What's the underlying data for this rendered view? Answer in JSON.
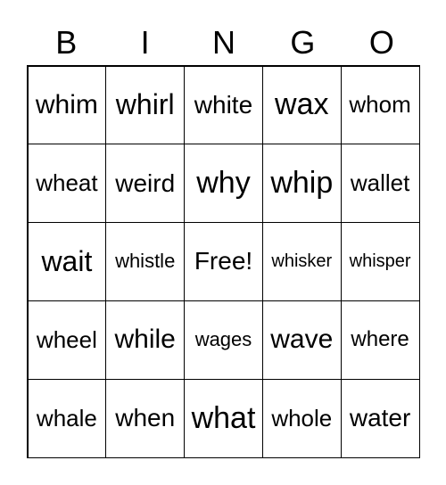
{
  "header": [
    "B",
    "I",
    "N",
    "G",
    "O"
  ],
  "cells": [
    "whim",
    "whirl",
    "white",
    "wax",
    "whom",
    "wheat",
    "weird",
    "why",
    "whip",
    "wallet",
    "wait",
    "whistle",
    "Free!",
    "whisker",
    "whisper",
    "wheel",
    "while",
    "wages",
    "wave",
    "where",
    "whale",
    "when",
    "what",
    "whole",
    "water"
  ]
}
